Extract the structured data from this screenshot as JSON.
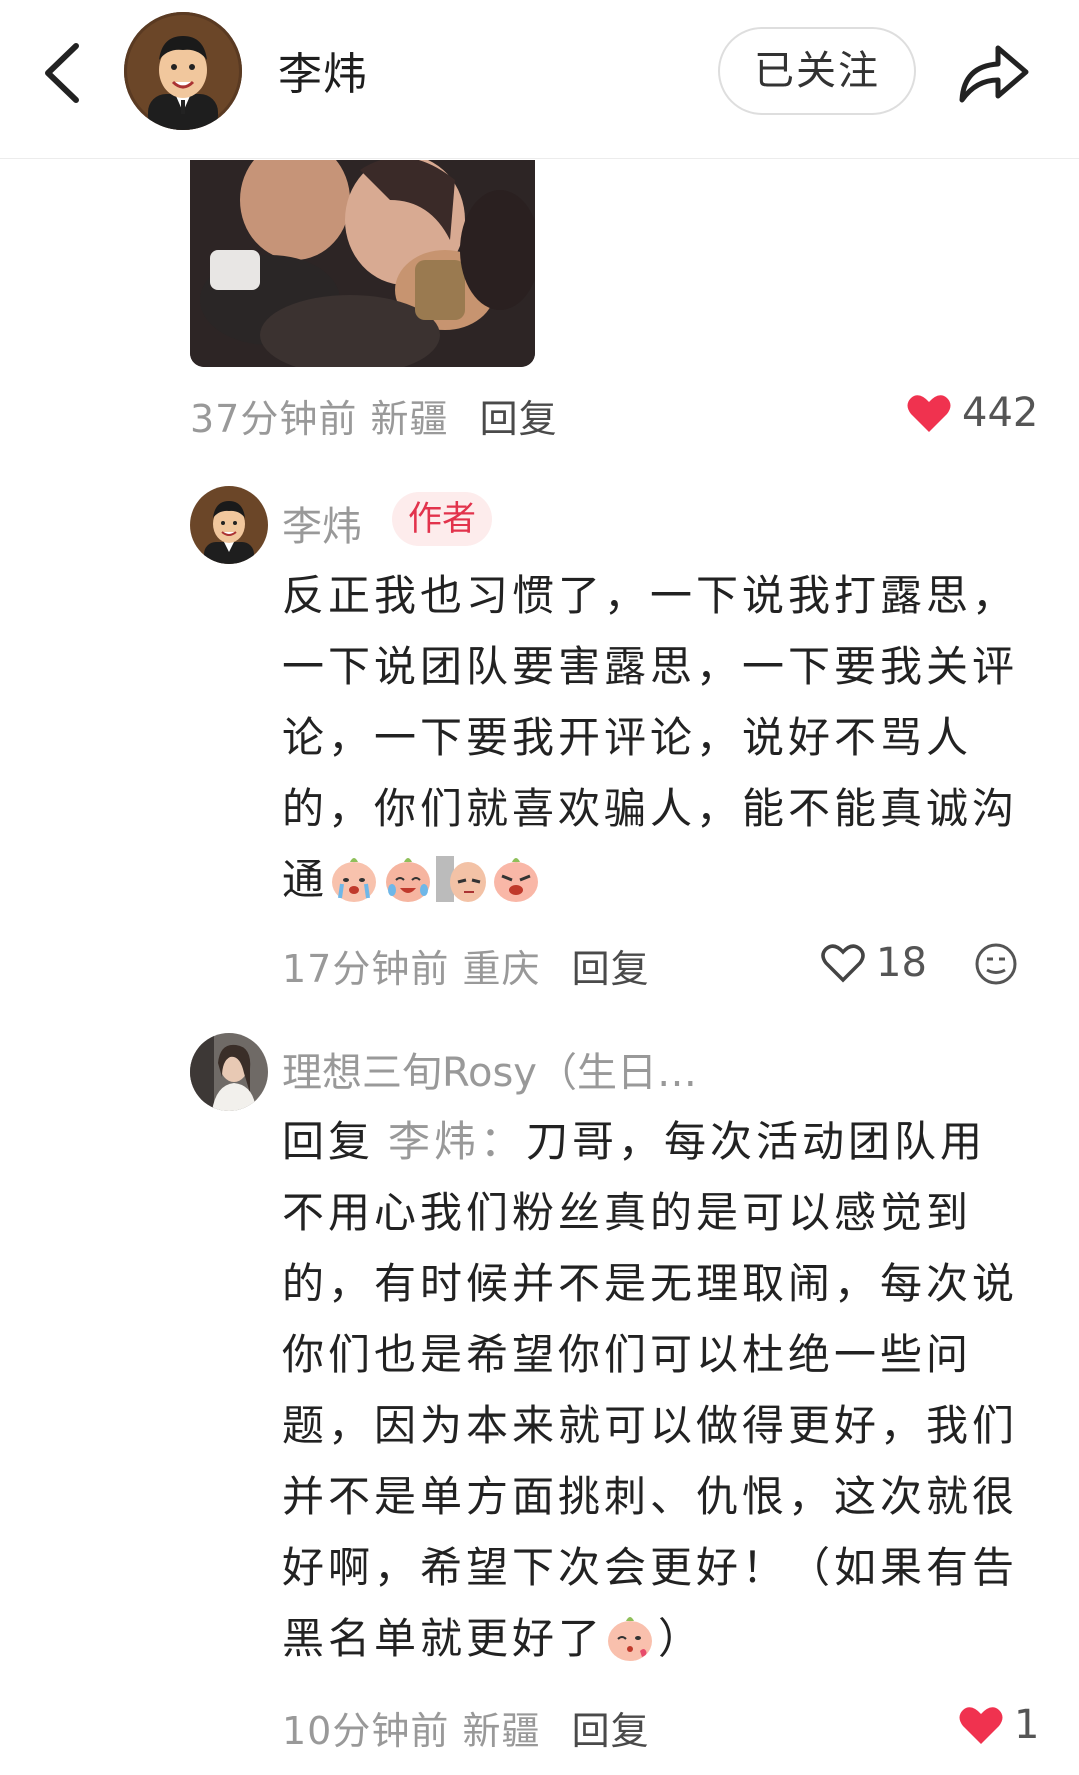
{
  "header": {
    "name": "李炜",
    "follow_label": "已关注",
    "icons": [
      "back-chevron-icon",
      "share-arrow-icon"
    ]
  },
  "comment1": {
    "time": "37分钟前",
    "location": "新疆",
    "reply_label": "回复",
    "likes": "442",
    "liked": true
  },
  "comment2": {
    "author": "李炜",
    "tag": "作者",
    "text_lines": [
      "反正我也习惯了，一下说我打露思，",
      "一下说团队要害露思，一下要我关评",
      "论，一下要我开评论，说好不骂人",
      "的，你们就喜欢骗人，能不能真诚沟",
      "通"
    ],
    "emojis": [
      "crying-peach-emoji",
      "crying-peach-emoji",
      "peeking-peach-emoji",
      "angry-peach-emoji"
    ],
    "time": "17分钟前",
    "location": "重庆",
    "reply_label": "回复",
    "likes": "18",
    "liked": false
  },
  "comment3": {
    "author": "理想三旬Rosy（生日…",
    "reply_prefix": "回复",
    "reply_to": "李炜：",
    "text_lines": [
      "刀哥，每次活动团队用",
      "不用心我们粉丝真的是可以感觉到",
      "的，有时候并不是无理取闹，每次说",
      "你们也是希望你们可以杜绝一些问",
      "题，因为本来就可以做得更好，我们",
      "并不是单方面挑刺、仇恨，这次就很",
      "好啊，希望下次会更好！（如果有告",
      "黑名单就更好了",
      "）"
    ],
    "emojis": [
      "kissing-peach-emoji"
    ],
    "time": "10分钟前",
    "location": "新疆",
    "reply_label": "回复",
    "likes": "1",
    "liked": true
  },
  "colors": {
    "like_red": "#f0324f",
    "author_tag_bg": "#fdecec",
    "author_tag_text": "#e2334c",
    "meta_grey": "#999999"
  }
}
